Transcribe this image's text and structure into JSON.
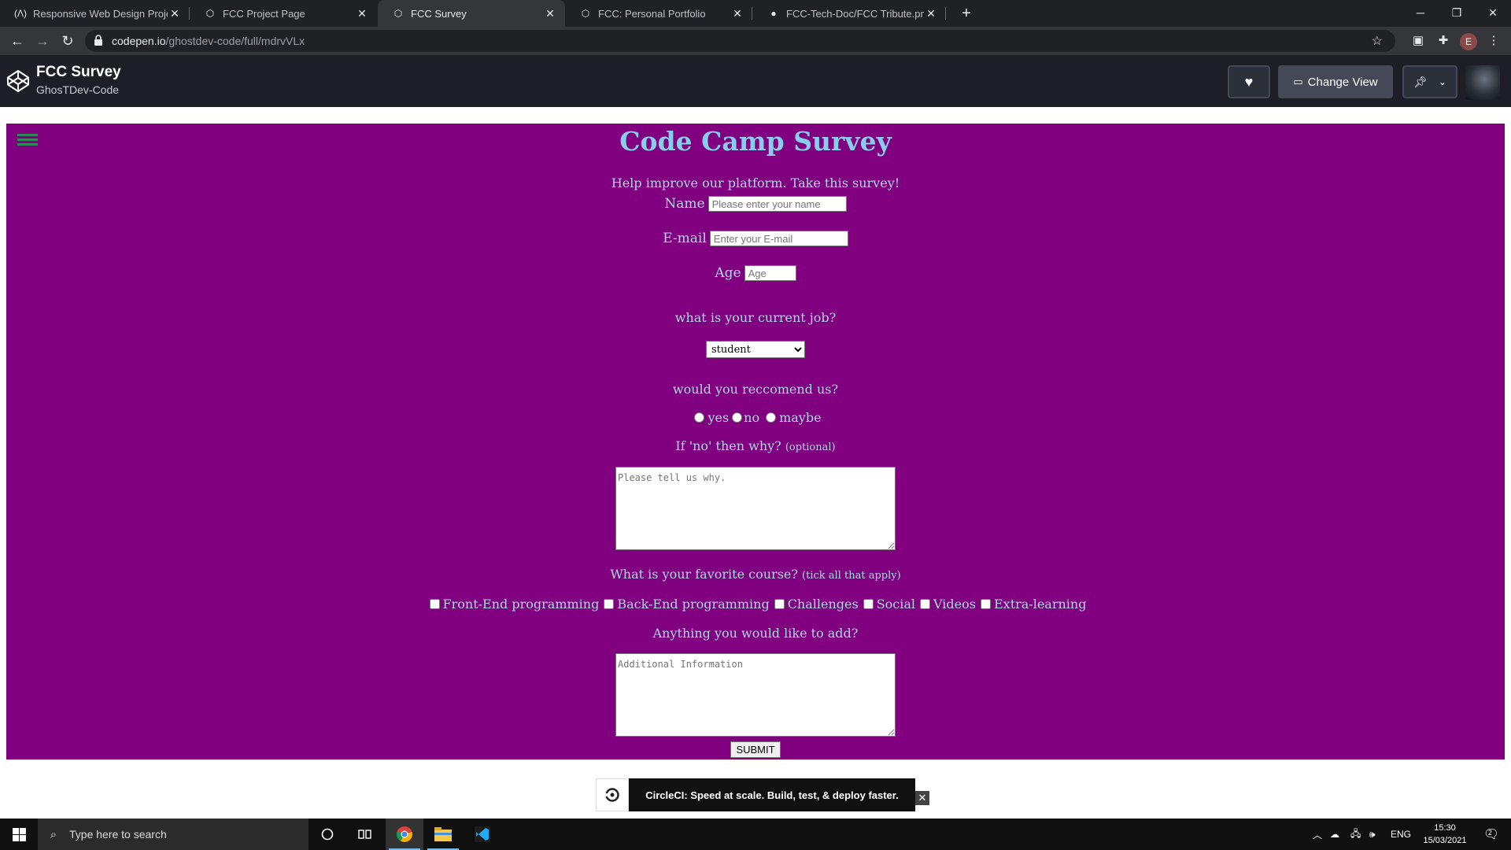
{
  "browser": {
    "tabs": [
      {
        "title": "Responsive Web Design Projects",
        "icon": "fcc-icon"
      },
      {
        "title": "FCC Project Page",
        "icon": "codepen-icon"
      },
      {
        "title": "FCC Survey",
        "icon": "codepen-icon",
        "active": true
      },
      {
        "title": "FCC: Personal Portfolio",
        "icon": "codepen-icon"
      },
      {
        "title": "FCC-Tech-Doc/FCC Tribute.png at",
        "icon": "github-icon"
      }
    ],
    "url_host": "codepen.io",
    "url_path": "/ghostdev-code/full/mdrvVLx",
    "profile_initial": "E"
  },
  "codepen": {
    "pen_title": "FCC Survey",
    "author": "GhosTDev-Code",
    "change_view_label": "Change View"
  },
  "survey": {
    "title": "Code Camp Survey",
    "description": "Help improve our platform. Take this survey!",
    "name_label": "Name",
    "name_placeholder": "Please enter your name",
    "email_label": "E-mail",
    "email_placeholder": "Enter your E-mail",
    "age_label": "Age",
    "age_placeholder": "Age",
    "job_question": "what is your current job?",
    "job_selected": "student",
    "recommend_question": "would you reccomend us?",
    "recommend_options": [
      "yes",
      "no",
      "maybe"
    ],
    "why_question": "If 'no' then why?",
    "why_hint": "(optional)",
    "why_placeholder": "Please tell us why.",
    "course_question": "What is your favorite course?",
    "course_hint": "(tick all that apply)",
    "courses": [
      "Front-End programming",
      "Back-End programming",
      "Challenges",
      "Social",
      "Videos",
      "Extra-learning"
    ],
    "add_question": "Anything you would like to add?",
    "add_placeholder": "Additional Information",
    "submit_label": "SUBMIT"
  },
  "ad": {
    "text": "CircleCI: Speed at scale. Build, test, & deploy faster."
  },
  "taskbar": {
    "search_placeholder": "Type here to search",
    "language": "ENG",
    "time": "15:30",
    "date": "15/03/2021",
    "notification_count": "2"
  }
}
